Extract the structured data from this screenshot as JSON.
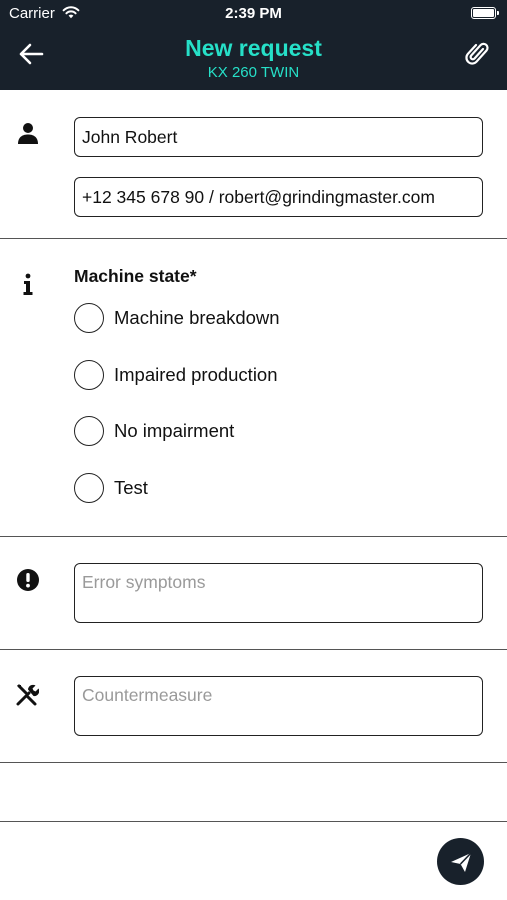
{
  "status_bar": {
    "carrier": "Carrier",
    "time": "2:39 PM"
  },
  "nav": {
    "title": "New request",
    "subtitle": "KX 260 TWIN",
    "back_icon": "back-arrow-icon",
    "attach_icon": "paperclip-icon"
  },
  "contact": {
    "icon": "person-icon",
    "name_value": "John Robert",
    "details_value": "+12 345 678 90 / robert@grindingmaster.com"
  },
  "machine_state": {
    "icon": "info-icon",
    "label": "Machine state*",
    "options": [
      "Machine breakdown",
      "Impaired production",
      "No impairment",
      "Test"
    ],
    "selected": null
  },
  "error_symptoms": {
    "icon": "exclamation-circle-icon",
    "placeholder": "Error symptoms",
    "value": ""
  },
  "countermeasure": {
    "icon": "tools-icon",
    "placeholder": "Countermeasure",
    "value": ""
  },
  "send": {
    "icon": "send-paper-plane-icon"
  },
  "colors": {
    "header_bg": "#18212b",
    "accent": "#26e0c8",
    "text": "#111111",
    "placeholder": "#9a9a9a"
  }
}
